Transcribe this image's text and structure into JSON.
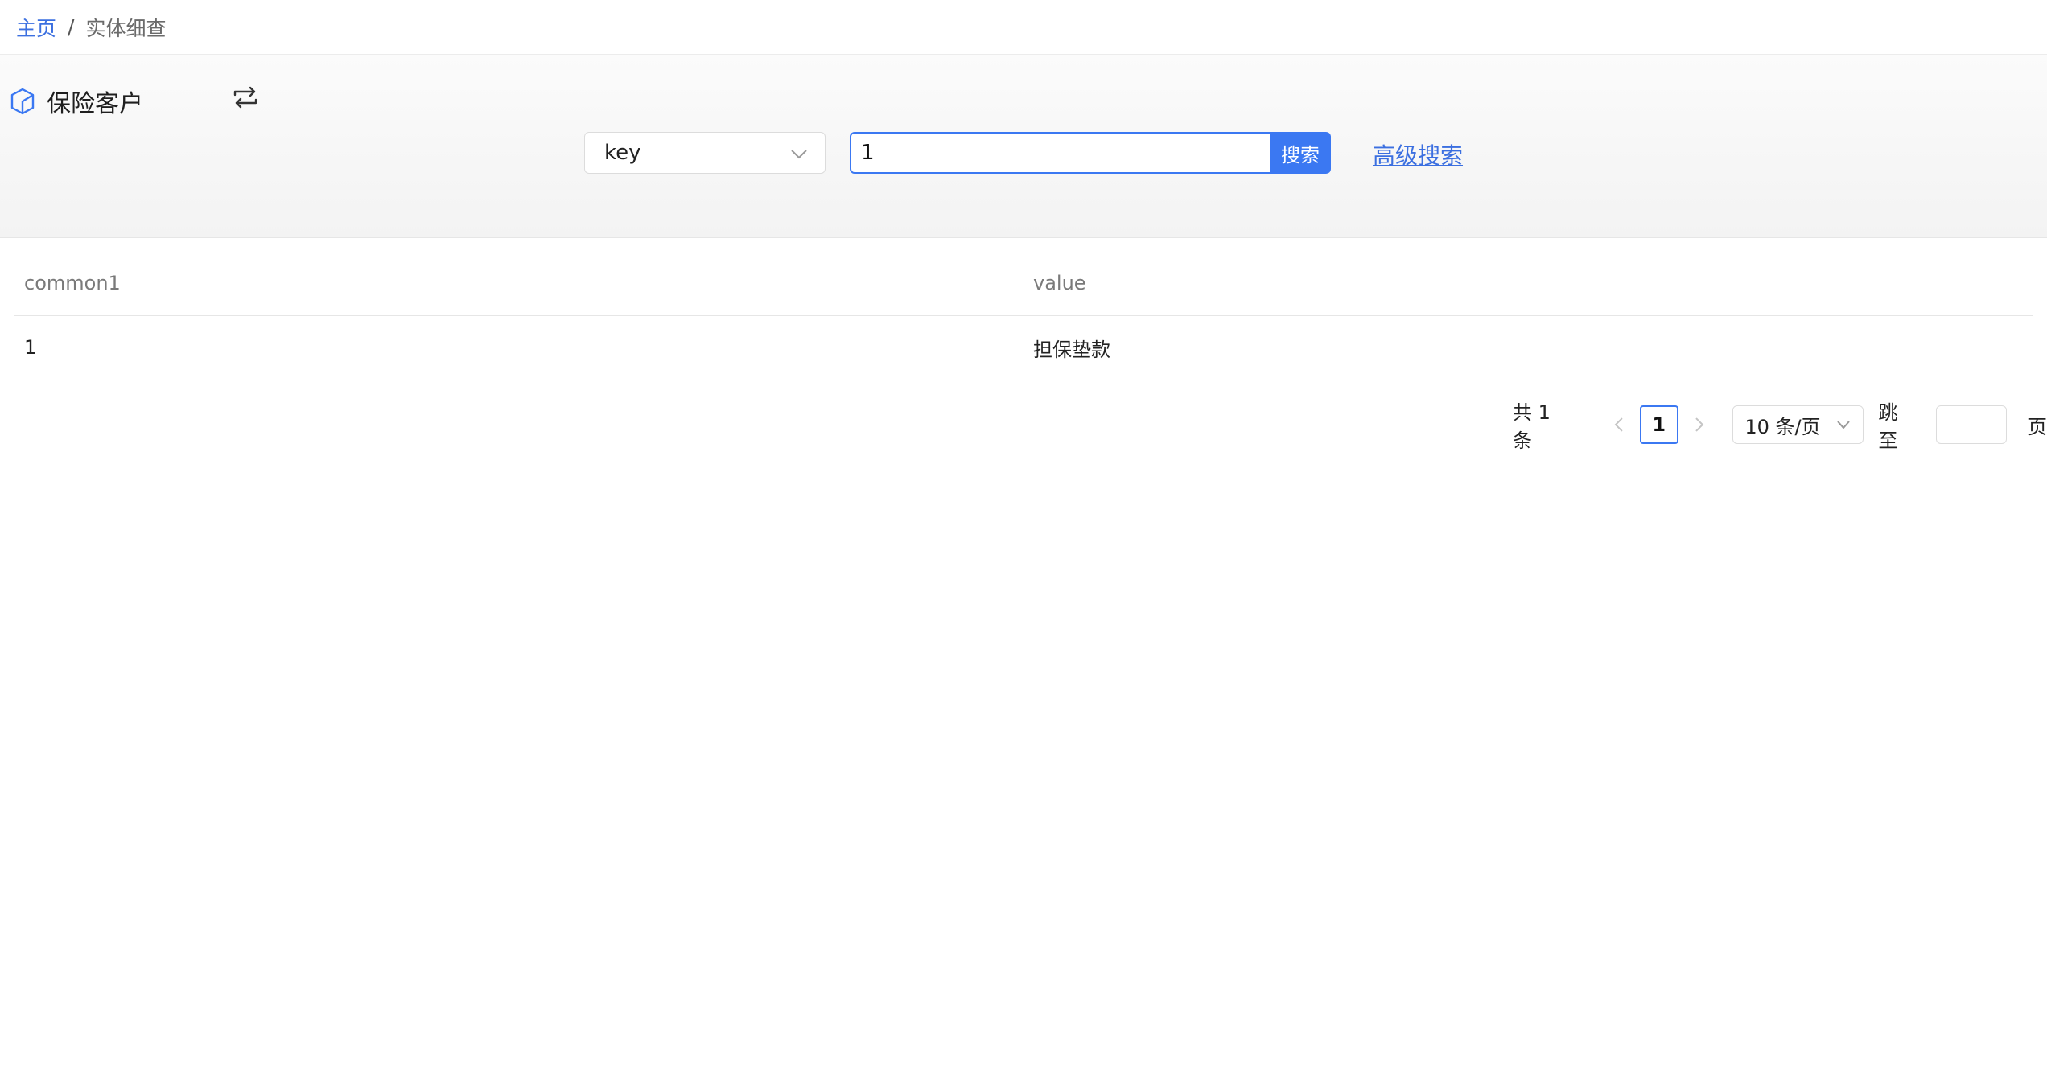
{
  "breadcrumb": {
    "home": "主页",
    "separator": "/",
    "current": "实体细查"
  },
  "entity": {
    "title": "保险客户",
    "icon": "cube-icon",
    "switch_icon": "switch-arrows-icon"
  },
  "search": {
    "field_select_value": "key",
    "input_value": "1",
    "button_label": "搜索",
    "advanced_link": "高级搜索"
  },
  "table": {
    "columns": [
      "common1",
      "value"
    ],
    "rows": [
      [
        "1",
        "担保垫款"
      ]
    ]
  },
  "pagination": {
    "total_text": "共 1 条",
    "current_page": "1",
    "page_size": "10 条/页",
    "jump_label": "跳至",
    "jump_value": "",
    "page_unit": "页"
  },
  "colors": {
    "accent": "#3b78f2",
    "link": "#3b6fe0"
  }
}
